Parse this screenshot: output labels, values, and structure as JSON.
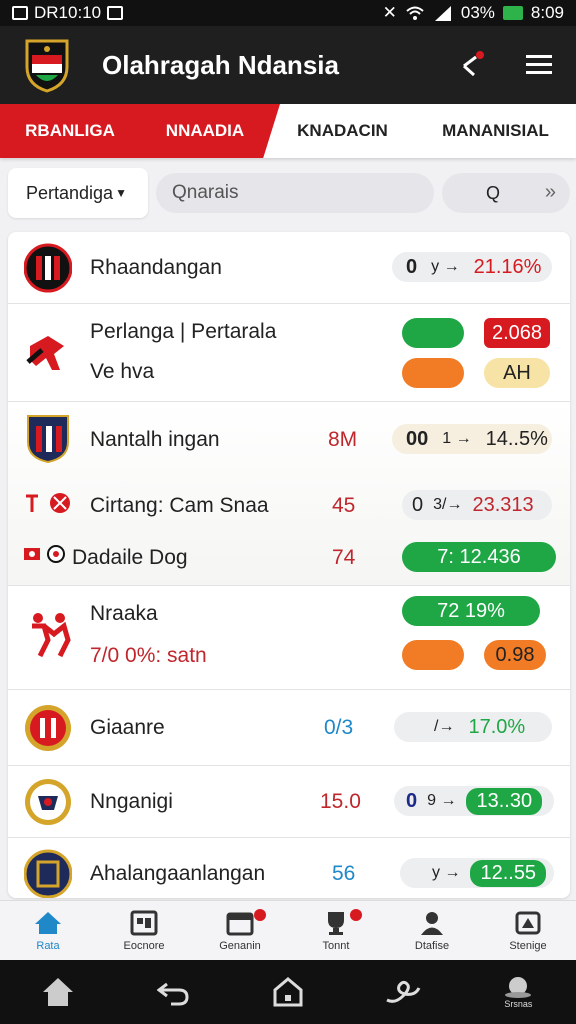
{
  "status_bar": {
    "time_left": "DR10:10",
    "battery": "03%",
    "clock": "8:09"
  },
  "app": {
    "title": "Olahragah Ndansia"
  },
  "tabs": [
    {
      "label": "RBANLIGA",
      "active": true
    },
    {
      "label": "NNAADIA",
      "active": true
    },
    {
      "label": "KNADACIN",
      "active": false
    },
    {
      "label": "MANANISIAL",
      "active": false
    }
  ],
  "filter": {
    "dropdown": "Pertandiga",
    "search_placeholder": "Qnarais",
    "query": "Q"
  },
  "rows": [
    {
      "name": "Rhaandangan",
      "mid": "",
      "left_val": "0",
      "arrow": "y →",
      "right_val": "21.16%"
    },
    {
      "name": "Perlanga | Pertarala",
      "name2": "Ve hva",
      "pill1": "",
      "pill2": "2.068",
      "pill3": "",
      "pill4": "AH"
    },
    {
      "name": "Nantalh ingan",
      "mid": "8M",
      "left_val": "00",
      "arrow": "1 →",
      "right_val": "14..5%"
    },
    {
      "name": "Cirtang: Cam Snaa",
      "mid": "45",
      "left_val": "0",
      "arrow": "3/→",
      "right_val": "23.313"
    },
    {
      "name": "Dadaile Dog",
      "mid": "74",
      "pill": "7:   12.436"
    },
    {
      "name": "Nraaka",
      "name2": "7/0 0%: satn",
      "pill1": "72   19%",
      "pill2": "0.98"
    },
    {
      "name": "Giaanre",
      "mid": "0/3",
      "arrow": "/→",
      "right_val": "17.0%"
    },
    {
      "name": "Nnganigi",
      "mid": "15.0",
      "left_val": "0",
      "arrow": "9 →",
      "right_val": "13..30"
    },
    {
      "name": "Ahalangaanlangan",
      "mid": "56",
      "arrow": "y →",
      "right_val": "12..55"
    }
  ],
  "bottom_nav": [
    {
      "label": "Rata",
      "icon": "home-icon"
    },
    {
      "label": "Eocnore",
      "icon": "scoreboard-icon"
    },
    {
      "label": "Genanin",
      "icon": "calendar-icon"
    },
    {
      "label": "Tonnt",
      "icon": "trophy-icon"
    },
    {
      "label": "Dtafise",
      "icon": "profile-icon"
    },
    {
      "label": "Stenige",
      "icon": "settings-icon"
    }
  ],
  "system_nav": {
    "extra_label": "Srsnas"
  },
  "colors": {
    "brand_red": "#d71920",
    "green": "#1fa746",
    "orange": "#f27c25",
    "blue_active": "#1e88c8"
  }
}
